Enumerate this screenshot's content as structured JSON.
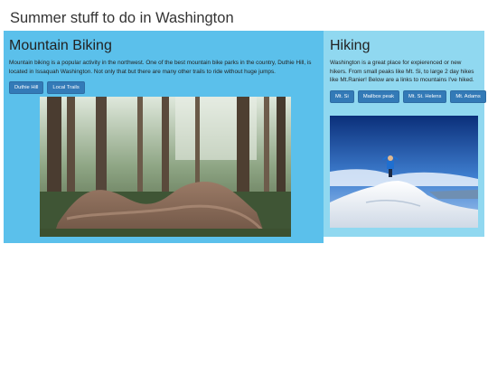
{
  "page": {
    "title": "Summer stuff to do in Washington"
  },
  "biking": {
    "heading": "Mountain Biking",
    "description": "Mountain biking is a popular activity in the northwest. One of the best mountain bike parks in the country, Duthie Hill, is located in Issaquah Washington. Not only that but there are many other trails to ride without huge jumps.",
    "buttons": [
      "Duthie Hill",
      "Local Trails"
    ],
    "background_color": "#5bc0eb"
  },
  "hiking": {
    "heading": "Hiking",
    "description": "Washington is a great place for expierenced or new hikers. From small peaks like Mt. Si, to large 2 day hikes like Mt.Ranier! Below are a links to mountains I've hiked.",
    "buttons": [
      "Mt. Si",
      "Mailbox peak",
      "Mt. St. Helens",
      "Mt. Adams"
    ],
    "background_color": "#90d8f0"
  },
  "button_color": "#337ab7"
}
